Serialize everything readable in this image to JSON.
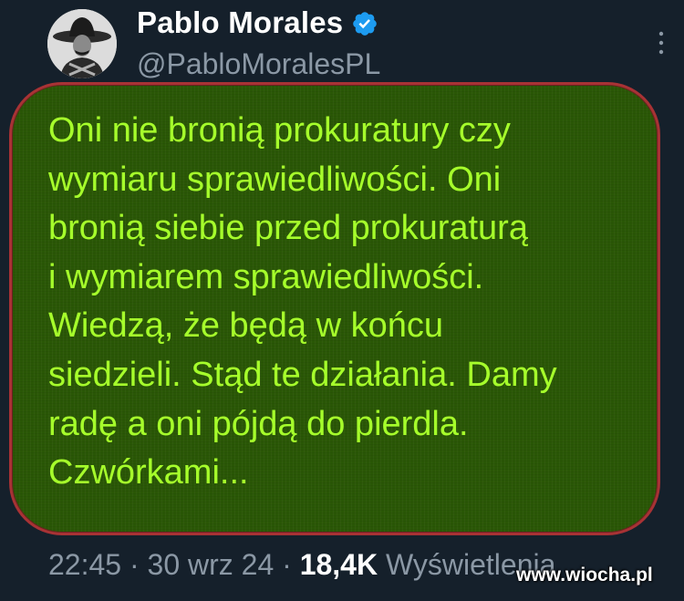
{
  "author": {
    "display_name": "Pablo Morales",
    "handle": "@PabloMoralesPL",
    "verified_icon": "verified-badge-icon",
    "avatar": "profile-photo"
  },
  "menu_icon": "more-options-icon",
  "tweet": {
    "lines": [
      "Oni nie bronią prokuratury czy",
      "wymiaru sprawiedliwości. Oni",
      "bronią siebie przed prokuraturą",
      "i wymiarem sprawiedliwości.",
      "Wiedzą, że będą w końcu",
      "siedzieli. Stąd te działania. Damy",
      "radę a oni pójdą do pierdla.",
      "Czwórkami..."
    ]
  },
  "meta": {
    "time": "22:45",
    "separator": "·",
    "date": "30 wrz 24",
    "views_count": "18,4K",
    "views_label": "Wyświetlenia"
  },
  "watermark": "www.wiocha.pl",
  "colors": {
    "background": "#15202b",
    "highlight_fill": "#2a5706",
    "highlight_border": "#a83235",
    "tweet_text": "#a6ff2b",
    "verified_blue": "#1d9bf0",
    "secondary_text": "#8b98a5"
  }
}
